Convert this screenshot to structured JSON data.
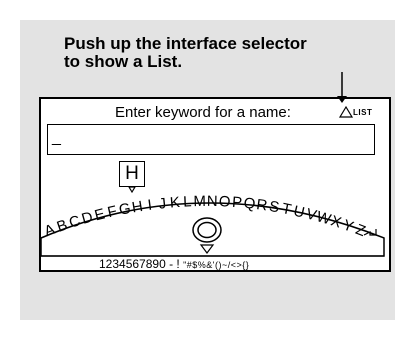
{
  "caption": {
    "line1": "Push up the interface selector",
    "line2": "to show a List."
  },
  "screen": {
    "prompt": "Enter keyword for a name:",
    "list_label": "LIST",
    "entry_value": "_",
    "selected_letter": "H",
    "arc_letters": [
      "A",
      "B",
      "C",
      "D",
      "E",
      "F",
      "G",
      "H",
      "I",
      "J",
      "K",
      "L",
      "M",
      "N",
      "O",
      "P",
      "Q",
      "R",
      "S",
      "T",
      "U",
      "V",
      "W",
      "X",
      "Y",
      "Z"
    ],
    "number_row": "1234567890 - !",
    "symbol_row": "\"#$%&'()~/<>{}"
  },
  "icons": [
    "up-triangle-icon",
    "backspace-icon",
    "down-arrow-icon",
    "selector-knob-icon"
  ]
}
